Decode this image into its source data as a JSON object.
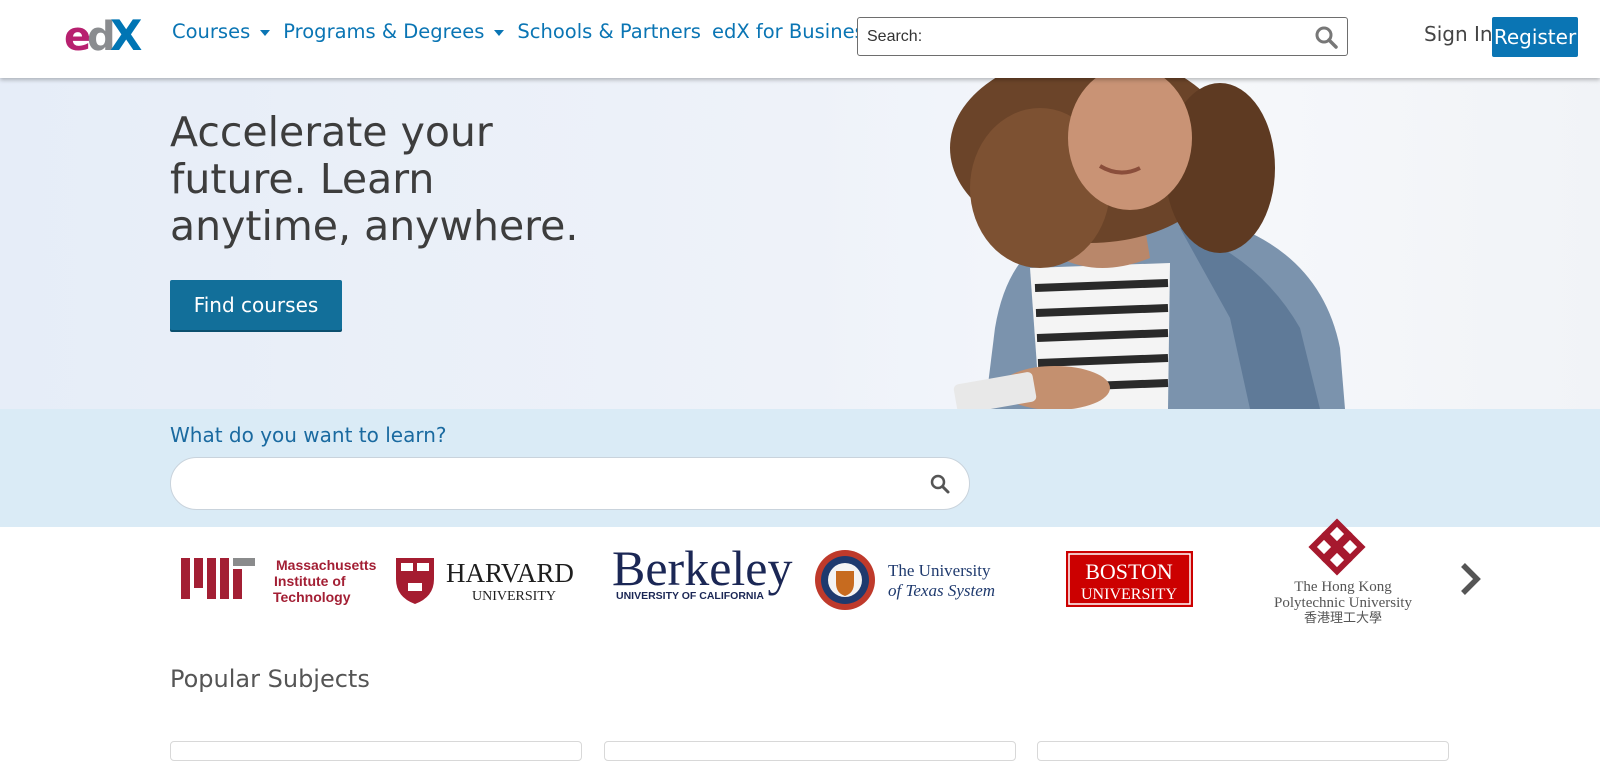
{
  "header": {
    "logo_alt": "edX",
    "nav": [
      {
        "label": "Courses",
        "has_dropdown": true
      },
      {
        "label": "Programs & Degrees",
        "has_dropdown": true
      },
      {
        "label": "Schools & Partners",
        "has_dropdown": false
      },
      {
        "label": "edX for Business",
        "has_dropdown": false
      }
    ],
    "search_placeholder": "Search:",
    "sign_in": "Sign In",
    "register": "Register"
  },
  "hero": {
    "title": "Accelerate your future. Learn anytime, anywhere.",
    "cta": "Find courses"
  },
  "learn": {
    "label": "What do you want to learn?",
    "placeholder": ""
  },
  "partners": [
    {
      "name": "Massachusetts Institute of Technology",
      "lines": [
        "Massachusetts",
        "Institute of",
        "Technology"
      ]
    },
    {
      "name": "Harvard University",
      "lines": [
        "HARVARD",
        "UNIVERSITY"
      ]
    },
    {
      "name": "Berkeley University of California",
      "lines": [
        "Berkeley",
        "UNIVERSITY OF CALIFORNIA"
      ]
    },
    {
      "name": "The University of Texas System",
      "lines": [
        "The University",
        "of Texas System"
      ]
    },
    {
      "name": "Boston University",
      "lines": [
        "BOSTON",
        "UNIVERSITY"
      ]
    },
    {
      "name": "The Hong Kong Polytechnic University",
      "lines": [
        "The Hong Kong",
        "Polytechnic University",
        "香港理工大學"
      ]
    }
  ],
  "popular_subjects_title": "Popular Subjects",
  "colors": {
    "brand_blue": "#0a75b4",
    "cta_blue": "#126f9a",
    "hero_bg": "#e4ecf8",
    "learn_bg": "#daebf6",
    "mit_red": "#a31f34",
    "bu_red": "#cc0000"
  }
}
